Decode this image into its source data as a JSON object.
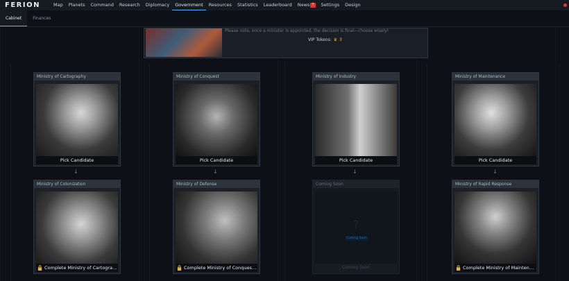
{
  "app": {
    "logo": "FERION"
  },
  "nav": {
    "items": [
      "Map",
      "Planets",
      "Command",
      "Research",
      "Diplomacy",
      "Government",
      "Resources",
      "Statistics",
      "Leaderboard",
      "News",
      "Settings",
      "Design"
    ],
    "active": "Government",
    "news_badge": "7"
  },
  "subtabs": {
    "items": [
      "Cabinet",
      "Finances"
    ],
    "active": "Cabinet"
  },
  "info": {
    "note": "Please note, once a minister is appointed, the decision is final—choose wisely!",
    "vip_label": "VIP Tokens:",
    "vip_count": "3"
  },
  "cards": [
    {
      "title": "Ministry of Cartography",
      "footer": "Pick Candidate",
      "locked": false
    },
    {
      "title": "Ministry of Conquest",
      "footer": "Pick Candidate",
      "locked": false
    },
    {
      "title": "Ministry of Industry",
      "footer": "Pick Candidate",
      "locked": false
    },
    {
      "title": "Ministry of Maintenance",
      "footer": "Pick Candidate",
      "locked": false
    },
    {
      "title": "Ministry of Colonization",
      "footer": "Complete Ministry of Cartograph...",
      "locked": true
    },
    {
      "title": "Ministry of Defense",
      "footer": "Complete Ministry of Conquest t...",
      "locked": true
    },
    {
      "title": "Coming Soon",
      "footer": "Coming Soon",
      "label": "Coming Soon",
      "soon": true
    },
    {
      "title": "Ministry of Rapid Response",
      "footer": "Complete Ministry of Maintenanc...",
      "locked": true
    }
  ],
  "colors": {
    "accent": "#58a6ff",
    "badge": "#da3633",
    "gold": "#e3b341"
  }
}
